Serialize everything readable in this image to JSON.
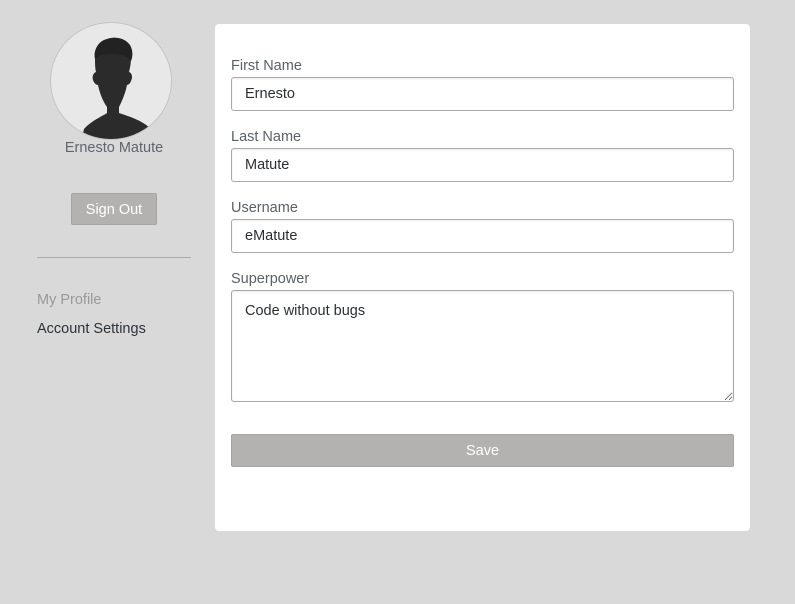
{
  "sidebar": {
    "avatar_icon": "user-silhouette-icon",
    "user_name": "Ernesto Matute",
    "sign_out_label": "Sign Out",
    "nav": {
      "my_profile": "My Profile",
      "account_settings": "Account Settings"
    }
  },
  "form": {
    "first_name": {
      "label": "First Name",
      "value": "Ernesto"
    },
    "last_name": {
      "label": "Last Name",
      "value": "Matute"
    },
    "username": {
      "label": "Username",
      "value": "eMatute"
    },
    "superpower": {
      "label": "Superpower",
      "value": "Code without bugs"
    },
    "save_label": "Save"
  },
  "colors": {
    "page_background": "#d9d9d9",
    "card_background": "#ffffff",
    "button_background": "#b3b2b0",
    "nav_active": "#999999",
    "avatar_silhouette": "#2b2b2b"
  }
}
